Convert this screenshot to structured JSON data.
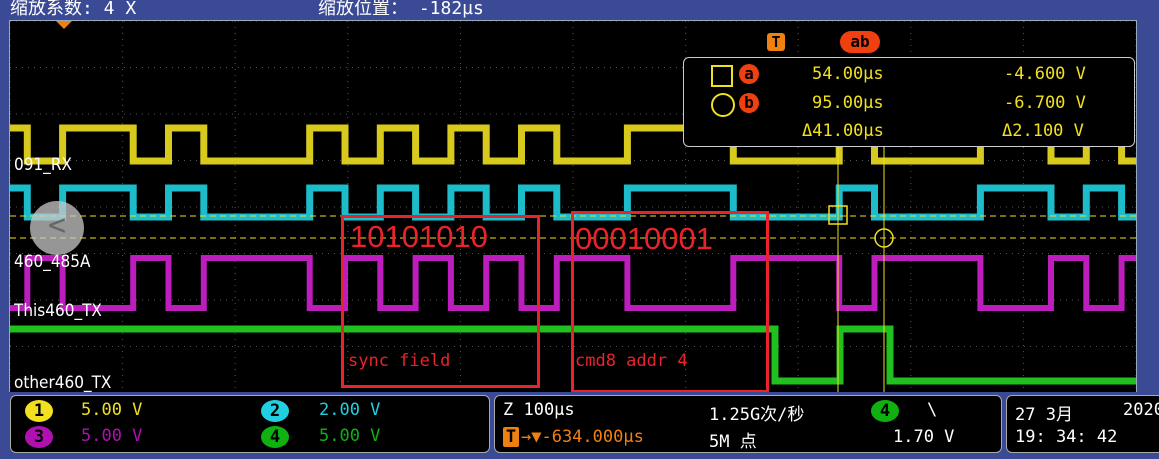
{
  "header": {
    "zoom_factor": "缩放系数: 4 X",
    "zoom_position": "缩放位置： -182µs"
  },
  "channels": [
    {
      "label": "091_RX",
      "color": "#f0e020"
    },
    {
      "label": "460_485A",
      "color": "#20d0e0"
    },
    {
      "label": "This460_TX",
      "color": "#d020d0"
    },
    {
      "label": "other460_TX",
      "color": "#20c020"
    }
  ],
  "annotations": {
    "sync_bits": "10101010",
    "sync_label": "sync field",
    "cmd_bits": "00010001",
    "cmd_label": "cmd8  addr 4"
  },
  "cursor": {
    "trigger_marker": "T",
    "ab_marker": "ab",
    "a_label": "a",
    "b_label": "b",
    "a_time": "54.00µs",
    "a_volt": "-4.600 V",
    "b_time": "95.00µs",
    "b_volt": "-6.700 V",
    "delta_time": "Δ41.00µs",
    "delta_volt": "Δ2.100 V"
  },
  "vertical": [
    {
      "num": "1",
      "scale": "5.00 V",
      "color": "#f0e020"
    },
    {
      "num": "2",
      "scale": "2.00 V",
      "color": "#20d0e0"
    },
    {
      "num": "3",
      "scale": "5.00 V",
      "color": "#b010b0"
    },
    {
      "num": "4",
      "scale": "5.00 V",
      "color": "#10b010"
    }
  ],
  "horizontal": {
    "timebase": "Z 100µs",
    "sample_rate": "1.25G次/秒",
    "trigger_icon": "T",
    "trigger_delay": "→▼-634.000µs",
    "record_length": "5M 点",
    "trigger_source": "4",
    "trigger_slope": "\\",
    "trigger_level": "1.70 V"
  },
  "datetime": {
    "date": "27 3月",
    "year": "2020",
    "time": "19: 34: 42"
  },
  "nav": {
    "back": "<"
  }
}
